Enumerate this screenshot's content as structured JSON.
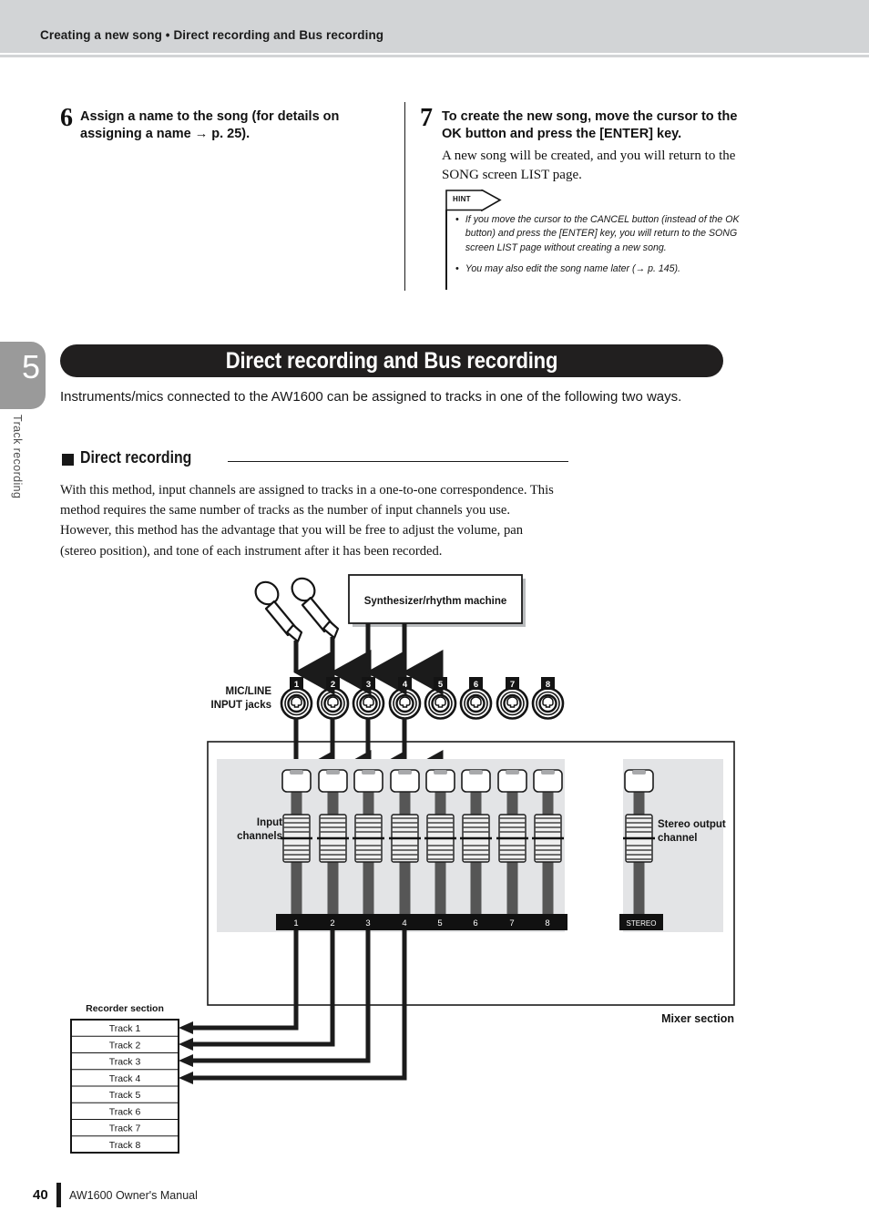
{
  "header": {
    "breadcrumb": "Creating a new song  •  Direct recording and Bus recording"
  },
  "steps": [
    {
      "number": "6",
      "heading": "Assign a name to the song (for details on assigning a name → p. 25)."
    },
    {
      "number": "7",
      "heading": "To create the new song, move the cursor to the OK button and press the [ENTER] key.",
      "body": "A new song will be created, and you will return to the SONG screen LIST page."
    }
  ],
  "hint": {
    "label": "HINT",
    "bullet": "•",
    "items": [
      "If you move the cursor to the CANCEL button (instead of the OK button) and press the [ENTER] key, you will return to the SONG screen LIST page without creating a new song.",
      "You may also edit the song name later (→ p. 145)."
    ]
  },
  "chapter": {
    "number": "5",
    "vertical_label": "Track recording"
  },
  "banner": {
    "title": "Direct recording and Bus recording"
  },
  "intro": "Instruments/mics connected to the AW1600 can be assigned to tracks in one of the following two ways.",
  "subsection": {
    "title": "Direct recording",
    "body": "With this method, input channels are assigned to tracks in a one-to-one correspondence. This method requires the same number of tracks as the number of input channels you use. However, this method has the advantage that you will be free to adjust the volume, pan (stereo position), and tone of each instrument after it has been recorded."
  },
  "diagram": {
    "source_box_label": "Synthesizer/rhythm machine",
    "jacks_label_line1": "MIC/LINE",
    "jacks_label_line2": "INPUT jacks",
    "jack_numbers": [
      "1",
      "2",
      "3",
      "4",
      "5",
      "6",
      "7",
      "8"
    ],
    "input_channels_label_line1": "Input",
    "input_channels_label_line2": "channels",
    "stereo_channel_label_line1": "Stereo output",
    "stereo_channel_label_line2": "channel",
    "bus_numbers": [
      "1",
      "2",
      "3",
      "4",
      "5",
      "6",
      "7",
      "8"
    ],
    "stereo_bus_label": "STEREO",
    "mixer_section_label": "Mixer section",
    "recorder_section_label": "Recorder section",
    "tracks": [
      "Track 1",
      "Track 2",
      "Track 3",
      "Track 4",
      "Track 5",
      "Track 6",
      "Track 7",
      "Track 8"
    ],
    "connected_jacks": [
      "1",
      "2",
      "3",
      "4"
    ],
    "mic_inputs": [
      "1",
      "2"
    ],
    "synth_inputs": [
      "3",
      "4"
    ],
    "routing": [
      {
        "bus": "1",
        "track": "Track 1"
      },
      {
        "bus": "2",
        "track": "Track 2"
      },
      {
        "bus": "3",
        "track": "Track 3"
      },
      {
        "bus": "4",
        "track": "Track 4"
      }
    ]
  },
  "footer": {
    "page_number": "40",
    "manual_title": "AW1600  Owner's Manual"
  },
  "colors": {
    "header_band": "#d2d4d6",
    "banner_bg": "#211f1f",
    "chapter_tab": "#9a9a9a",
    "mixer_panel": "#e3e4e6",
    "bus_bar": "#111111",
    "fader_track": "#565656"
  }
}
